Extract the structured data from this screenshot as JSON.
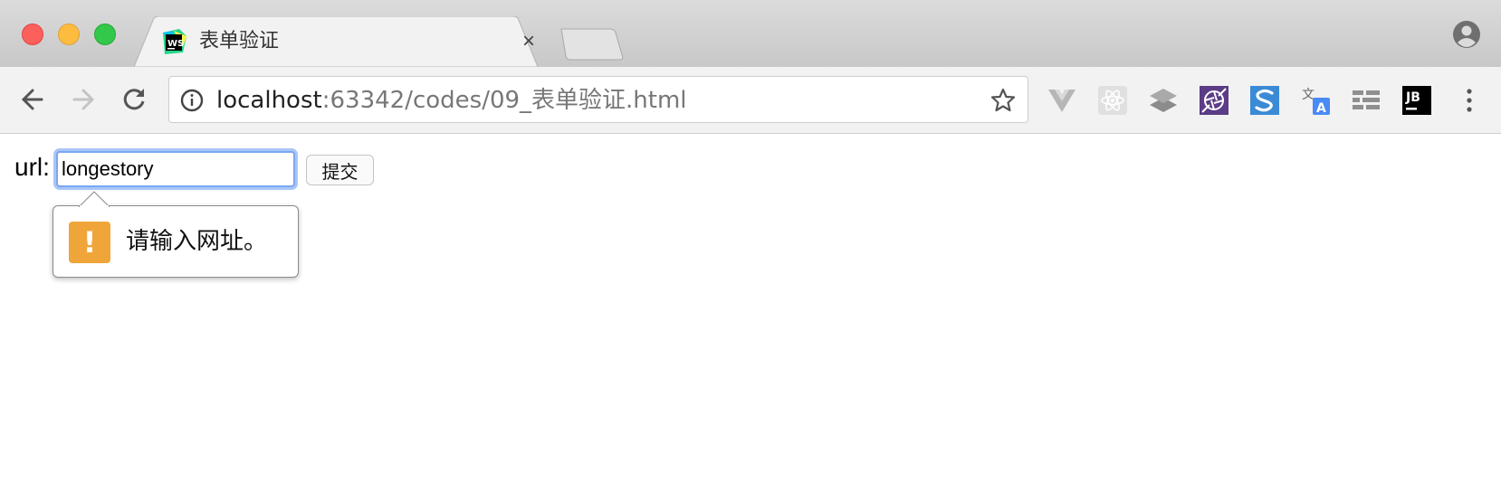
{
  "browser": {
    "tab": {
      "title": "表单验证",
      "close_glyph": "×",
      "favicon": "webstorm-icon"
    },
    "address": {
      "host": "localhost",
      "rest": ":63342/codes/09_表单验证.html"
    },
    "extensions": [
      "vue-devtools-icon",
      "react-devtools-icon",
      "layers-icon",
      "aperture-icon",
      "s-icon",
      "translate-icon",
      "grid-icon",
      "jetbrains-icon"
    ],
    "jb_label": "JB"
  },
  "form": {
    "label": "url:",
    "input_value": "longestory",
    "submit_label": "提交"
  },
  "validation": {
    "icon_glyph": "!",
    "message": "请输入网址。"
  }
}
